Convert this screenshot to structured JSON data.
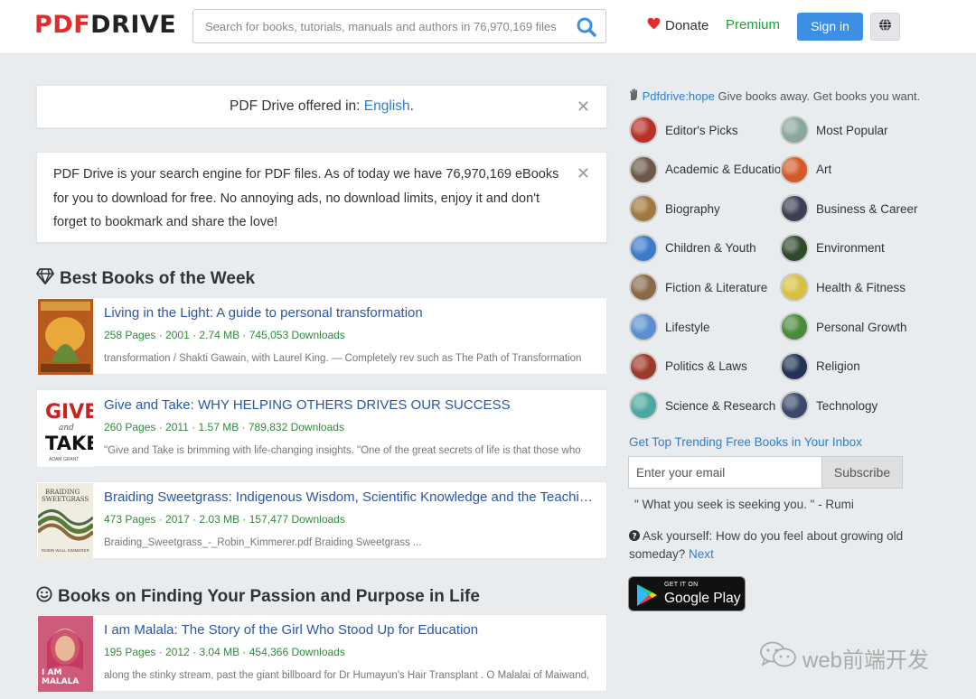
{
  "header": {
    "logo_pdf": "PDF",
    "logo_drive": "DRIVE",
    "search_placeholder": "Search for books, tutorials, manuals and authors in 76,970,169 files",
    "donate_label": "Donate",
    "premium_label": "Premium",
    "signin_label": "Sign in"
  },
  "notice_lang": {
    "text": "PDF Drive offered in: ",
    "link": "English",
    "suffix": "."
  },
  "notice_intro": {
    "text": "PDF Drive is your search engine for PDF files. As of today we have 76,970,169 eBooks for you to download for free. No annoying ads, no download limits, enjoy it and don't forget to bookmark and share the love!"
  },
  "sections": [
    {
      "title": "Best Books of the Week",
      "books": [
        {
          "title": "Living in the Light: A guide to personal transformation",
          "meta": "258 Pages · 2001 · 2.74 MB · 745,053 Downloads",
          "snippet": "transformation / Shakti Gawain, with Laurel King. — Completely rev such as The Path of Transformation"
        },
        {
          "title": "Give and Take: WHY HELPING OTHERS DRIVES OUR SUCCESS",
          "meta": "260 Pages · 2011 · 1.57 MB · 789,832 Downloads",
          "snippet": "\"Give and Take is brimming with life-changing insights. \"One of the great secrets of life is that those who"
        },
        {
          "title": "Braiding Sweetgrass: Indigenous Wisdom, Scientific Knowledge and the Teachings of Plants",
          "meta": "473 Pages · 2017 · 2.03 MB · 157,477 Downloads",
          "snippet": "Braiding_Sweetgrass_-_Robin_Kimmerer.pdf Braiding Sweetgrass ..."
        }
      ]
    },
    {
      "title": "Books on Finding Your Passion and Purpose in Life",
      "books": [
        {
          "title": "I am Malala: The Story of the Girl Who Stood Up for Education",
          "meta": "195 Pages · 2012 · 3.04 MB · 454,366 Downloads",
          "snippet": "along the stinky stream, past the giant billboard for Dr Humayun's Hair Transplant . O Malalai of Maiwand,"
        }
      ]
    }
  ],
  "covers": {
    "give_take_line1": "GIVE",
    "give_take_line2": "and",
    "give_take_line3": "TAKE",
    "give_take_author": "ADAM GRANT",
    "braiding_line1": "BRAIDING",
    "braiding_line2": "SWEETGRASS",
    "braiding_author": "ROBIN WALL KIMMERER",
    "malala_title": "I AM MALALA"
  },
  "sidebar": {
    "hope_link": "Pdfdrive:hope",
    "hope_text": " Give books away. Get books you want.",
    "categories": [
      {
        "label": "Editor's Picks",
        "color": "#b8302a"
      },
      {
        "label": "Most Popular",
        "color": "#8aa89a"
      },
      {
        "label": "Academic & Education",
        "color": "#6b5a48"
      },
      {
        "label": "Art",
        "color": "#d45a2a"
      },
      {
        "label": "Biography",
        "color": "#a07840"
      },
      {
        "label": "Business & Career",
        "color": "#3a3f52"
      },
      {
        "label": "Children & Youth",
        "color": "#3a7bc8"
      },
      {
        "label": "Environment",
        "color": "#2f4a2a"
      },
      {
        "label": "Fiction & Literature",
        "color": "#8a6a4a"
      },
      {
        "label": "Health & Fitness",
        "color": "#d8c040"
      },
      {
        "label": "Lifestyle",
        "color": "#5a8fd0"
      },
      {
        "label": "Personal Growth",
        "color": "#4a8a3a"
      },
      {
        "label": "Politics & Laws",
        "color": "#9a3a2a"
      },
      {
        "label": "Religion",
        "color": "#223355"
      },
      {
        "label": "Science & Research",
        "color": "#4aa8a0"
      },
      {
        "label": "Technology",
        "color": "#3a4a6a"
      }
    ],
    "trend_title": "Get Top Trending Free Books in Your Inbox",
    "email_placeholder": "Enter your email",
    "subscribe_label": "Subscribe",
    "quote": "\" What you seek is seeking you. \"  - Rumi",
    "ask_text": "Ask yourself: How do you feel about growing old someday? ",
    "ask_link": "Next",
    "gplay_small": "GET IT ON",
    "gplay_big": "Google Play"
  },
  "watermark": "web前端开发"
}
